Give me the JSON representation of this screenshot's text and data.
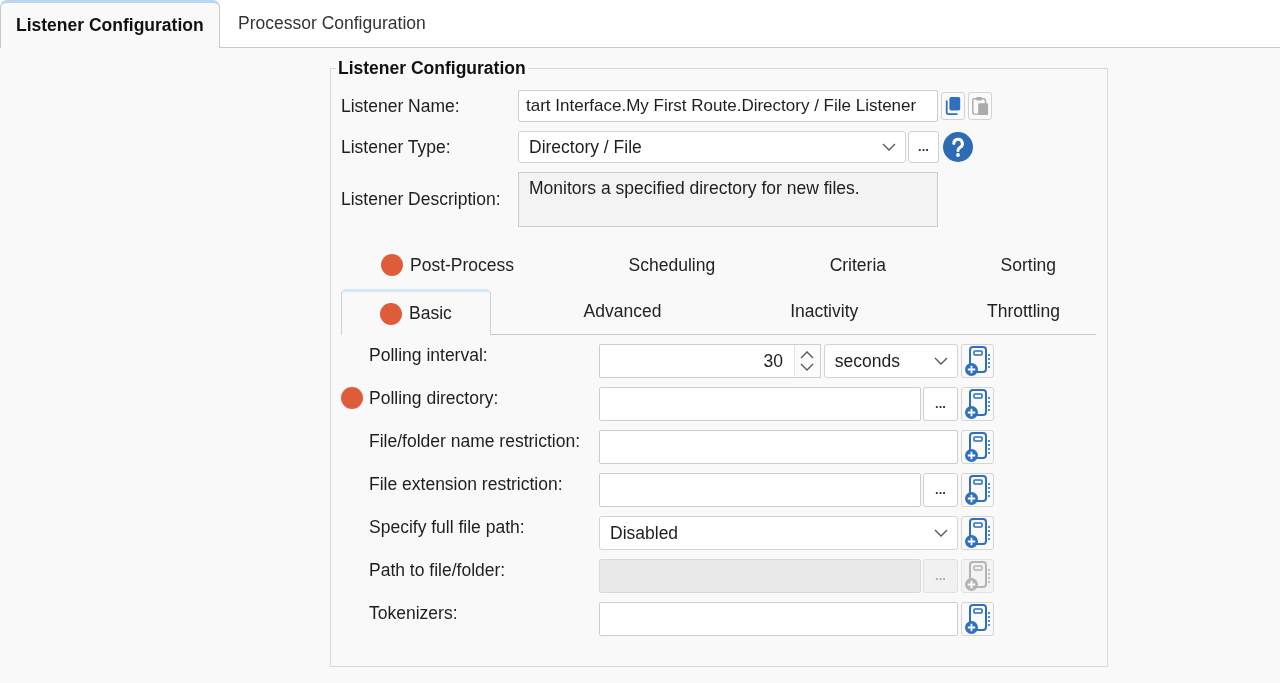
{
  "tabs": [
    {
      "label": "Listener Configuration",
      "selected": true
    },
    {
      "label": "Processor Configuration",
      "selected": false
    }
  ],
  "listener_configuration": {
    "title": "Listener Configuration",
    "name": {
      "label": "Listener Name:",
      "value": "tart Interface.My First Route.Directory / File Listener",
      "actions": [
        {
          "kind": "copy",
          "disabled": false
        },
        {
          "kind": "paste",
          "disabled": true
        }
      ]
    },
    "type": {
      "label": "Listener Type:",
      "value": "Directory / File",
      "button": "..."
    },
    "description": {
      "label": "Listener Description:",
      "value": "Monitors a specified directory for new files."
    },
    "settings_tabs": [
      {
        "tabs": [
          {
            "label": "Post-Process",
            "selected": false,
            "alert": true
          },
          {
            "label": "Scheduling",
            "selected": false,
            "alert": false
          },
          {
            "label": "Criteria",
            "selected": false,
            "alert": false
          },
          {
            "label": "Sorting",
            "selected": false,
            "alert": false
          }
        ]
      },
      {
        "tabs": [
          {
            "label": "Basic",
            "selected": true,
            "alert": true
          },
          {
            "label": "Advanced",
            "selected": false,
            "alert": false
          },
          {
            "label": "Inactivity",
            "selected": false,
            "alert": false
          },
          {
            "label": "Throttling",
            "selected": false,
            "alert": false
          }
        ]
      }
    ],
    "basic_fields": [
      {
        "kind": "spinner",
        "label": "Polling interval:",
        "value": "30",
        "unit": "seconds",
        "alert": false,
        "disabled": false
      },
      {
        "kind": "browse",
        "label": "Polling directory:",
        "button": "...",
        "alert": true,
        "disabled": false
      },
      {
        "kind": "text",
        "label": "File/folder name restriction:",
        "alert": false,
        "disabled": false
      },
      {
        "kind": "browse",
        "label": "File extension restriction:",
        "button": "...",
        "alert": false,
        "disabled": false
      },
      {
        "kind": "select",
        "label": "Specify full file path:",
        "value": "Disabled",
        "alert": false,
        "disabled": false
      },
      {
        "kind": "browse",
        "label": "Path to file/folder:",
        "button": "...",
        "alert": false,
        "disabled": true
      },
      {
        "kind": "text",
        "label": "Tokenizers:",
        "alert": false,
        "disabled": false
      }
    ]
  }
}
